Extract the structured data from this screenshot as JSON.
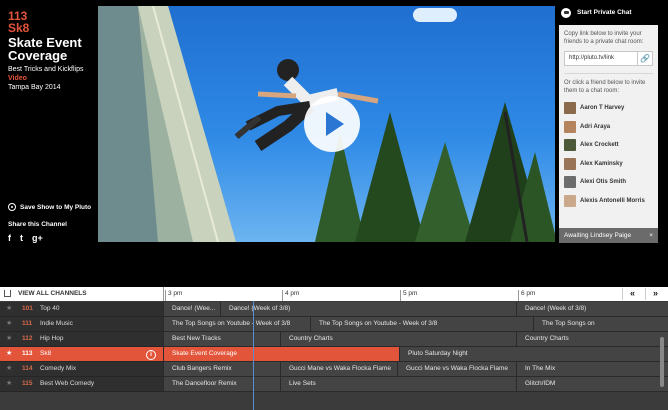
{
  "channel": {
    "number": "113",
    "name": "Sk8",
    "show_title": "Skate Event Coverage",
    "show_subtitle": "Best Tricks and Kickflips",
    "show_type": "Video",
    "show_location": "Tampa Bay 2014"
  },
  "actions": {
    "save_label": "Save Show to My Pluto",
    "share_label": "Share this Channel",
    "share_icons": [
      "facebook-icon",
      "twitter-icon",
      "google-plus-icon"
    ],
    "share_glyphs": [
      "f",
      "t",
      "g+"
    ]
  },
  "video": {
    "icon": "play-icon"
  },
  "chat": {
    "title": "Start Private Chat",
    "copy_note": "Copy link below to invite your friends to a private chat room:",
    "link": "http://pluto.tv/link",
    "link_icon": "link-icon",
    "friend_note": "Or click a friend below to invite them to a chat room:",
    "friends": [
      {
        "name": "Aaron T Harvey",
        "color": "#8a6a4a"
      },
      {
        "name": "Adri Araya",
        "color": "#b5845c"
      },
      {
        "name": "Alex Crockett",
        "color": "#4c5a3a"
      },
      {
        "name": "Alex Kaminsky",
        "color": "#9a7456"
      },
      {
        "name": "Alexi Otis Smith",
        "color": "#6d6d6d"
      },
      {
        "name": "Alexis Antonelli Morris",
        "color": "#c9a98a"
      }
    ],
    "status": "Awaiting Lindsey Paige",
    "close": "×"
  },
  "guide": {
    "view_all": "VIEW ALL CHANNELS",
    "times": [
      "3 pm",
      "4 pm",
      "5 pm",
      "6 pm"
    ],
    "prev": "«",
    "next": "»",
    "rows": [
      {
        "num": "101",
        "name": "Top 40",
        "cells": [
          "Dance! (Wee...",
          "Dance! (Week of 3/8)",
          "Dance! (Week of 3/8)"
        ]
      },
      {
        "num": "111",
        "name": "Indie Music",
        "cells": [
          "The Top Songs on Youtube - Week of 3/8",
          "The Top Songs on Youtube - Week of 3/8",
          "The Top Songs on"
        ]
      },
      {
        "num": "112",
        "name": "Hip Hop",
        "cells": [
          "Best New Tracks",
          "Country Charts",
          "Country Charts"
        ]
      },
      {
        "num": "113",
        "name": "Sk8",
        "cells": [
          "Skate Event Coverage",
          "Pluto Saturday Night"
        ]
      },
      {
        "num": "114",
        "name": "Comedy Mix",
        "cells": [
          "Club Bangers Remix",
          "Gucci Mane vs Waka Flocka Flame",
          "Gucci Mane vs Waka Flocka Flame",
          "In The Mix"
        ]
      },
      {
        "num": "115",
        "name": "Best Web Comedy",
        "cells": [
          "The Dancefloor Remix",
          "Live Sets",
          "Glitch/IDM"
        ]
      }
    ],
    "info": "i"
  },
  "colors": {
    "accent": "#e2553a",
    "panel": "#f1f1f1",
    "guide_bg": "#3b3b3b"
  }
}
